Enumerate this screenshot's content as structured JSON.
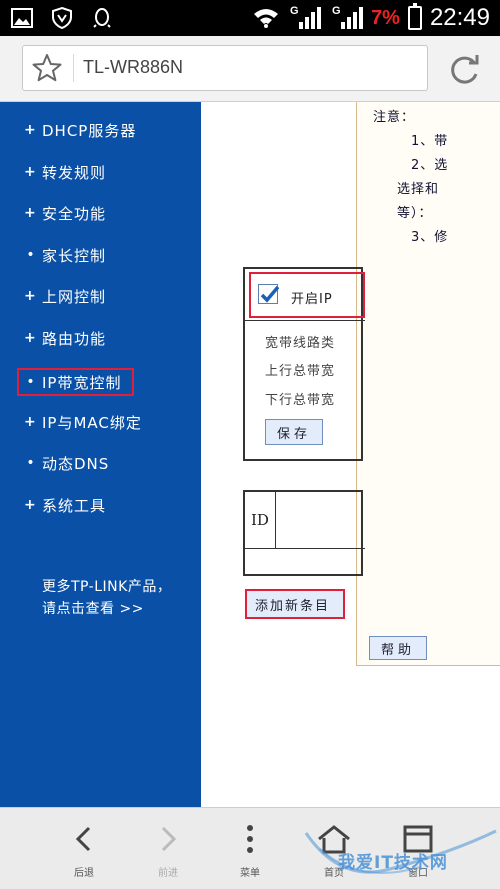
{
  "status_bar": {
    "network_1": "G",
    "network_2": "G",
    "battery_percent": "7%",
    "time": "22:49",
    "battery_color": "#e22222"
  },
  "address_bar": {
    "url": "TL-WR886N"
  },
  "sidebar": {
    "background": "#0a50a6",
    "items": [
      {
        "label": "DHCP服务器",
        "marker": "+"
      },
      {
        "label": "转发规则",
        "marker": "+"
      },
      {
        "label": "安全功能",
        "marker": "+"
      },
      {
        "label": "家长控制",
        "marker": "•"
      },
      {
        "label": "上网控制",
        "marker": "+"
      },
      {
        "label": "路由功能",
        "marker": "+"
      },
      {
        "label": "IP带宽控制",
        "marker": "•",
        "highlighted": true
      },
      {
        "label": "IP与MAC绑定",
        "marker": "+"
      },
      {
        "label": "动态DNS",
        "marker": "•"
      },
      {
        "label": "系统工具",
        "marker": "+"
      }
    ],
    "promo_line1": "更多TP-LINK产品，",
    "promo_line2": "请点击查看 >>"
  },
  "main": {
    "notes": {
      "heading": "注意：",
      "line1": "1、带",
      "line2": "2、选",
      "line3": "选择和",
      "line4": "等）：",
      "line5": "3、修"
    },
    "enable_label": "开启IP",
    "enable_checked": true,
    "fields": {
      "line_type": "宽带线路类",
      "upload_total": "上行总带宽",
      "download_total": "下行总带宽"
    },
    "save_button": "保存",
    "table": {
      "id_header": "ID"
    },
    "add_entry_button": "添加新条目",
    "help_button": "帮助"
  },
  "toolbar": {
    "back": "后退",
    "forward": "前进",
    "menu": "菜单",
    "home": "首页",
    "pages": "窗口"
  },
  "watermark": "我爱IT技术网"
}
